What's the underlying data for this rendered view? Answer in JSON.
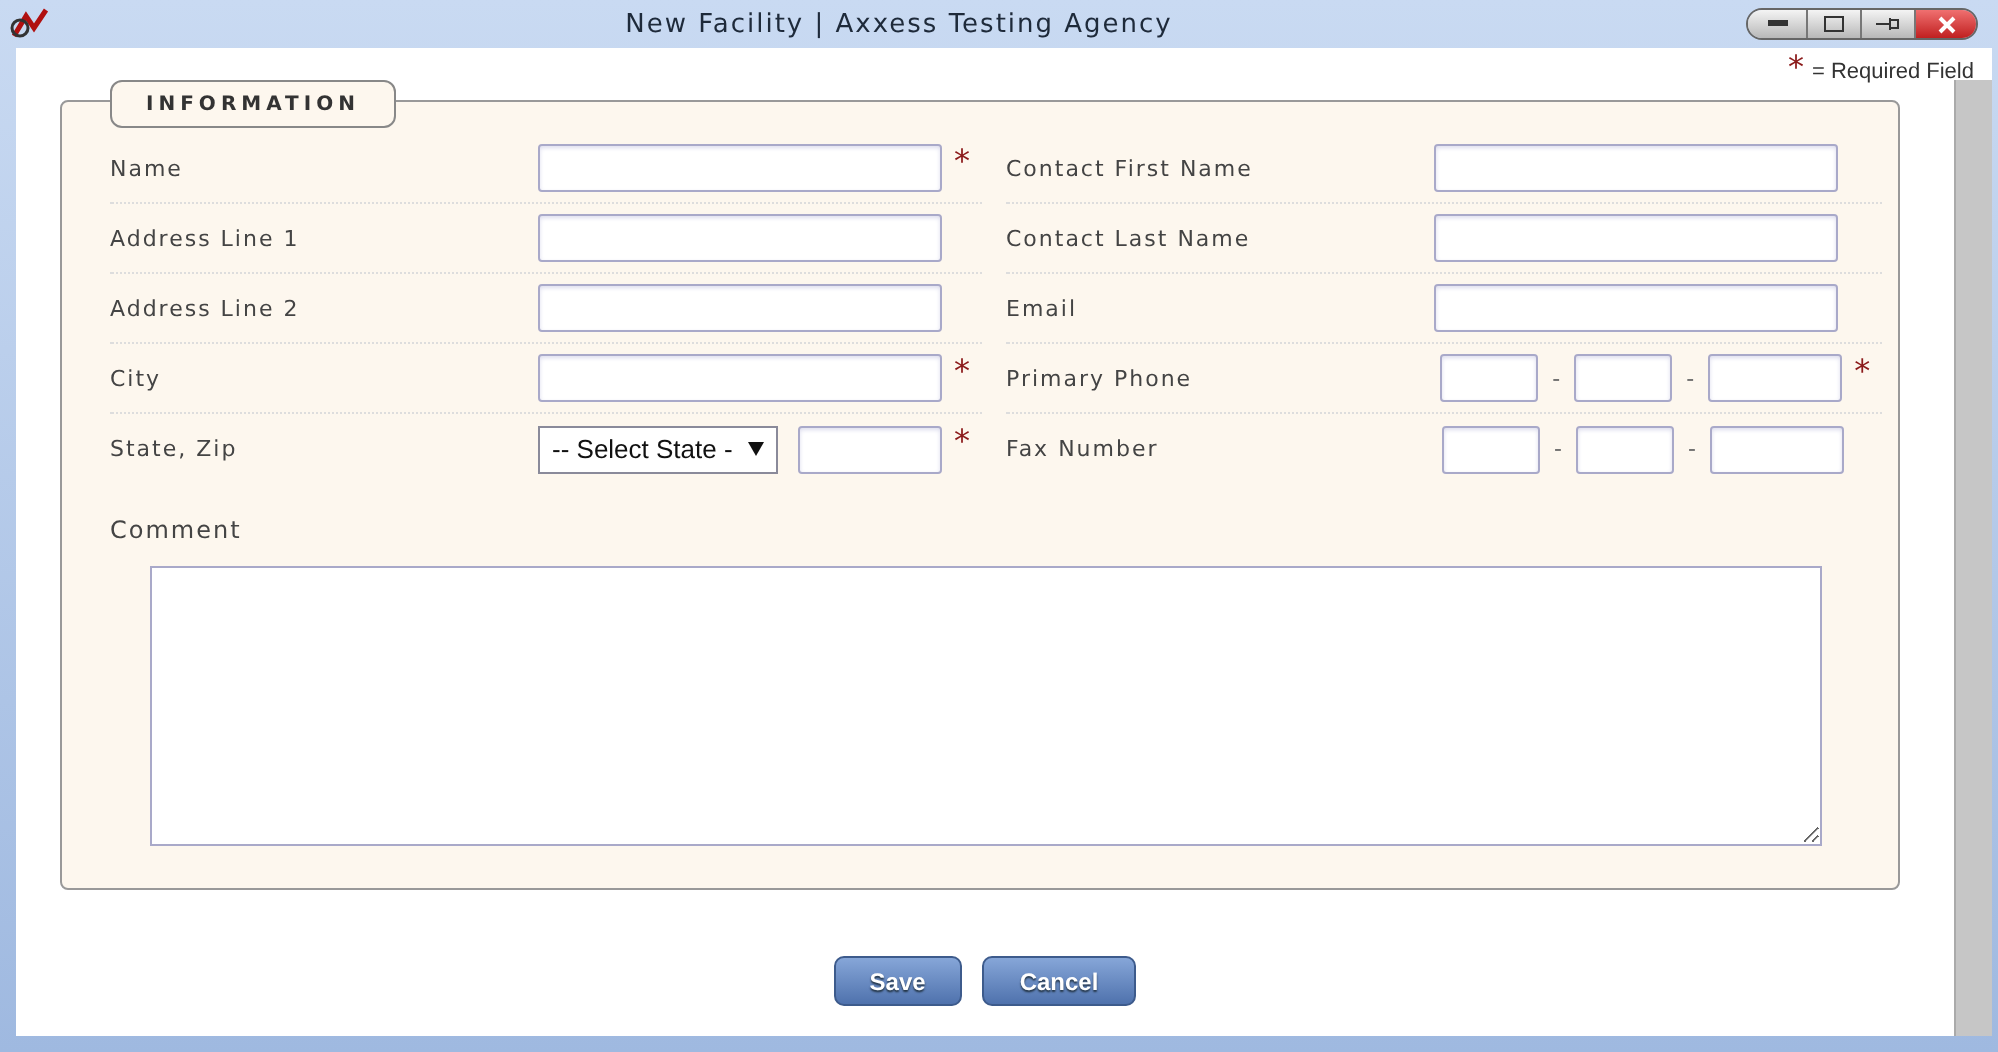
{
  "window": {
    "title": "New Facility | Axxess Testing Agency"
  },
  "required_note": {
    "mark": "*",
    "text": "= Required Field"
  },
  "section": {
    "legend": "INFORMATION"
  },
  "left_fields": [
    {
      "label": "Name",
      "kind": "text",
      "required_mark": "*"
    },
    {
      "label": "Address Line 1",
      "kind": "text"
    },
    {
      "label": "Address Line 2",
      "kind": "text"
    },
    {
      "label": "City",
      "kind": "text",
      "required_mark": "*"
    },
    {
      "label": "State, Zip",
      "kind": "state_zip",
      "select_value": "-- Select State -",
      "required_mark": "*"
    }
  ],
  "right_fields": [
    {
      "label": "Contact First Name",
      "kind": "text"
    },
    {
      "label": "Contact Last Name",
      "kind": "text"
    },
    {
      "label": "Email",
      "kind": "text"
    },
    {
      "label": "Primary Phone",
      "kind": "phone",
      "separators": [
        "-",
        "-"
      ],
      "required_mark": "*"
    },
    {
      "label": "Fax Number",
      "kind": "phone",
      "separators": [
        "-",
        "-"
      ]
    }
  ],
  "comment": {
    "label": "Comment"
  },
  "buttons": [
    {
      "label": "Save"
    },
    {
      "label": "Cancel"
    }
  ]
}
